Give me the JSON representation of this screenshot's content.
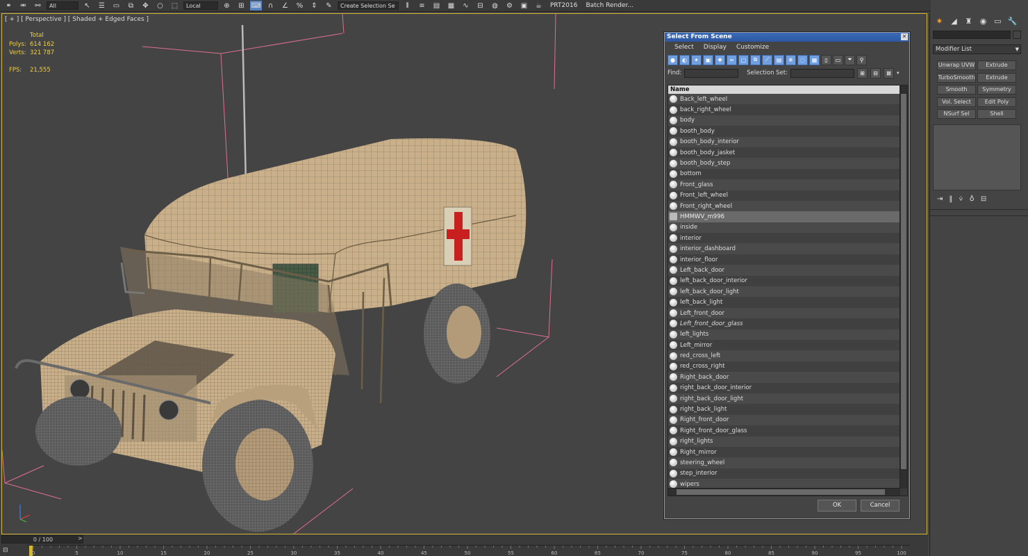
{
  "toolbar": {
    "view_dropdown": "All",
    "coord_dropdown": "Local",
    "selection_set": "Create Selection Se",
    "preset": "PRT2016",
    "batch_render": "Batch Render..."
  },
  "viewport": {
    "label": "[ + ] [ Perspective ] [ Shaded + Edged Faces ]",
    "stats": {
      "header": "Total",
      "polys_label": "Polys:",
      "polys_value": "614 162",
      "verts_label": "Verts:",
      "verts_value": "321 787",
      "fps_label": "FPS:",
      "fps_value": "21,555"
    }
  },
  "dialog": {
    "title": "Select From Scene",
    "menu": [
      "Select",
      "Display",
      "Customize"
    ],
    "find_label": "Find:",
    "selection_set_label": "Selection Set:",
    "column_header": "Name",
    "items": [
      {
        "name": "Back_left_wheel"
      },
      {
        "name": "back_right_wheel"
      },
      {
        "name": "body"
      },
      {
        "name": "booth_body"
      },
      {
        "name": "booth_body_interior"
      },
      {
        "name": "booth_body_jasket"
      },
      {
        "name": "booth_body_step"
      },
      {
        "name": "bottom"
      },
      {
        "name": "Front_glass"
      },
      {
        "name": "Front_left_wheel"
      },
      {
        "name": "Front_right_wheel"
      },
      {
        "name": "HMMWV_m996",
        "selected": true
      },
      {
        "name": "inside"
      },
      {
        "name": "interior"
      },
      {
        "name": "interior_dashboard"
      },
      {
        "name": "interior_floor"
      },
      {
        "name": "Left_back_door"
      },
      {
        "name": "left_back_door_interior"
      },
      {
        "name": "left_back_door_light"
      },
      {
        "name": "left_back_light"
      },
      {
        "name": "Left_front_door"
      },
      {
        "name": "Left_front_door_glass",
        "italic": true
      },
      {
        "name": "left_lights"
      },
      {
        "name": "Left_mirror"
      },
      {
        "name": "red_cross_left"
      },
      {
        "name": "red_cross_right"
      },
      {
        "name": "Right_back_door"
      },
      {
        "name": "right_back_door_interior"
      },
      {
        "name": "right_back_door_light"
      },
      {
        "name": "right_back_light"
      },
      {
        "name": "Right_front_door"
      },
      {
        "name": "Right_front_door_glass"
      },
      {
        "name": "right_lights"
      },
      {
        "name": "Right_mirror"
      },
      {
        "name": "steering_wheel"
      },
      {
        "name": "step_interior"
      },
      {
        "name": "wipers"
      }
    ],
    "ok_label": "OK",
    "cancel_label": "Cancel"
  },
  "command_panel": {
    "modifier_list": "Modifier List",
    "buttons": [
      "Unwrap UVW",
      "Extrude",
      "TurboSmooth",
      "Extrude",
      "Smooth",
      "Symmetry",
      "Vol. Select",
      "Edit Poly",
      "NSurf Sel",
      "Shell"
    ]
  },
  "timeline": {
    "frame_display": "0 / 100",
    "ticks": [
      "0",
      "5",
      "10",
      "15",
      "20",
      "25",
      "30",
      "35",
      "40",
      "45",
      "50",
      "55",
      "60",
      "65",
      "70",
      "75",
      "80",
      "85",
      "90",
      "95",
      "100"
    ]
  },
  "colors": {
    "viewport_bg": "#444444",
    "active_viewport_border": "#d4b830",
    "stats_text": "#f0d040",
    "dialog_title": "#2c57a0",
    "accent_blue": "#5b86c4",
    "model_tan": "#c9b08a",
    "red_cross": "#c81f1f",
    "bbox_pink": "#e07090"
  }
}
